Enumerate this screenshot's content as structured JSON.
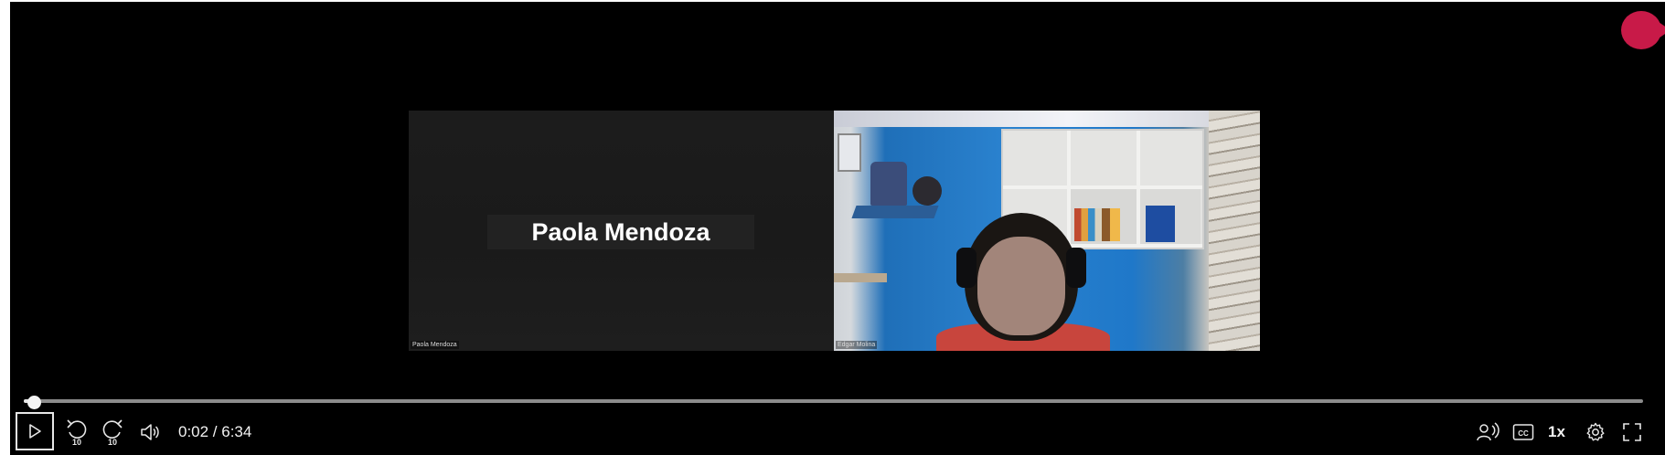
{
  "video": {
    "participant_left": {
      "display_name": "Paola Mendoza",
      "tile_label": "Paola Mendoza"
    },
    "participant_right": {
      "tile_label": "Edgar Molina"
    }
  },
  "playback": {
    "current_time": "0:02",
    "duration": "6:34",
    "time_display": "0:02 / 6:34",
    "progress_fraction": 0.005,
    "skip_back_seconds": "10",
    "skip_forward_seconds": "10",
    "speed_label": "1x"
  },
  "icons": {
    "play": "play-icon",
    "rewind": "rewind-10-icon",
    "forward": "forward-10-icon",
    "volume": "volume-icon",
    "audio_description": "audio-description-icon",
    "captions": "closed-captions-icon",
    "settings": "gear-icon",
    "fullscreen": "fullscreen-icon"
  },
  "colors": {
    "player_background": "#000000",
    "record_indicator": "#c81a48",
    "progress_track": "#8c8c8c",
    "progress_fill": "#e6e6e6"
  }
}
